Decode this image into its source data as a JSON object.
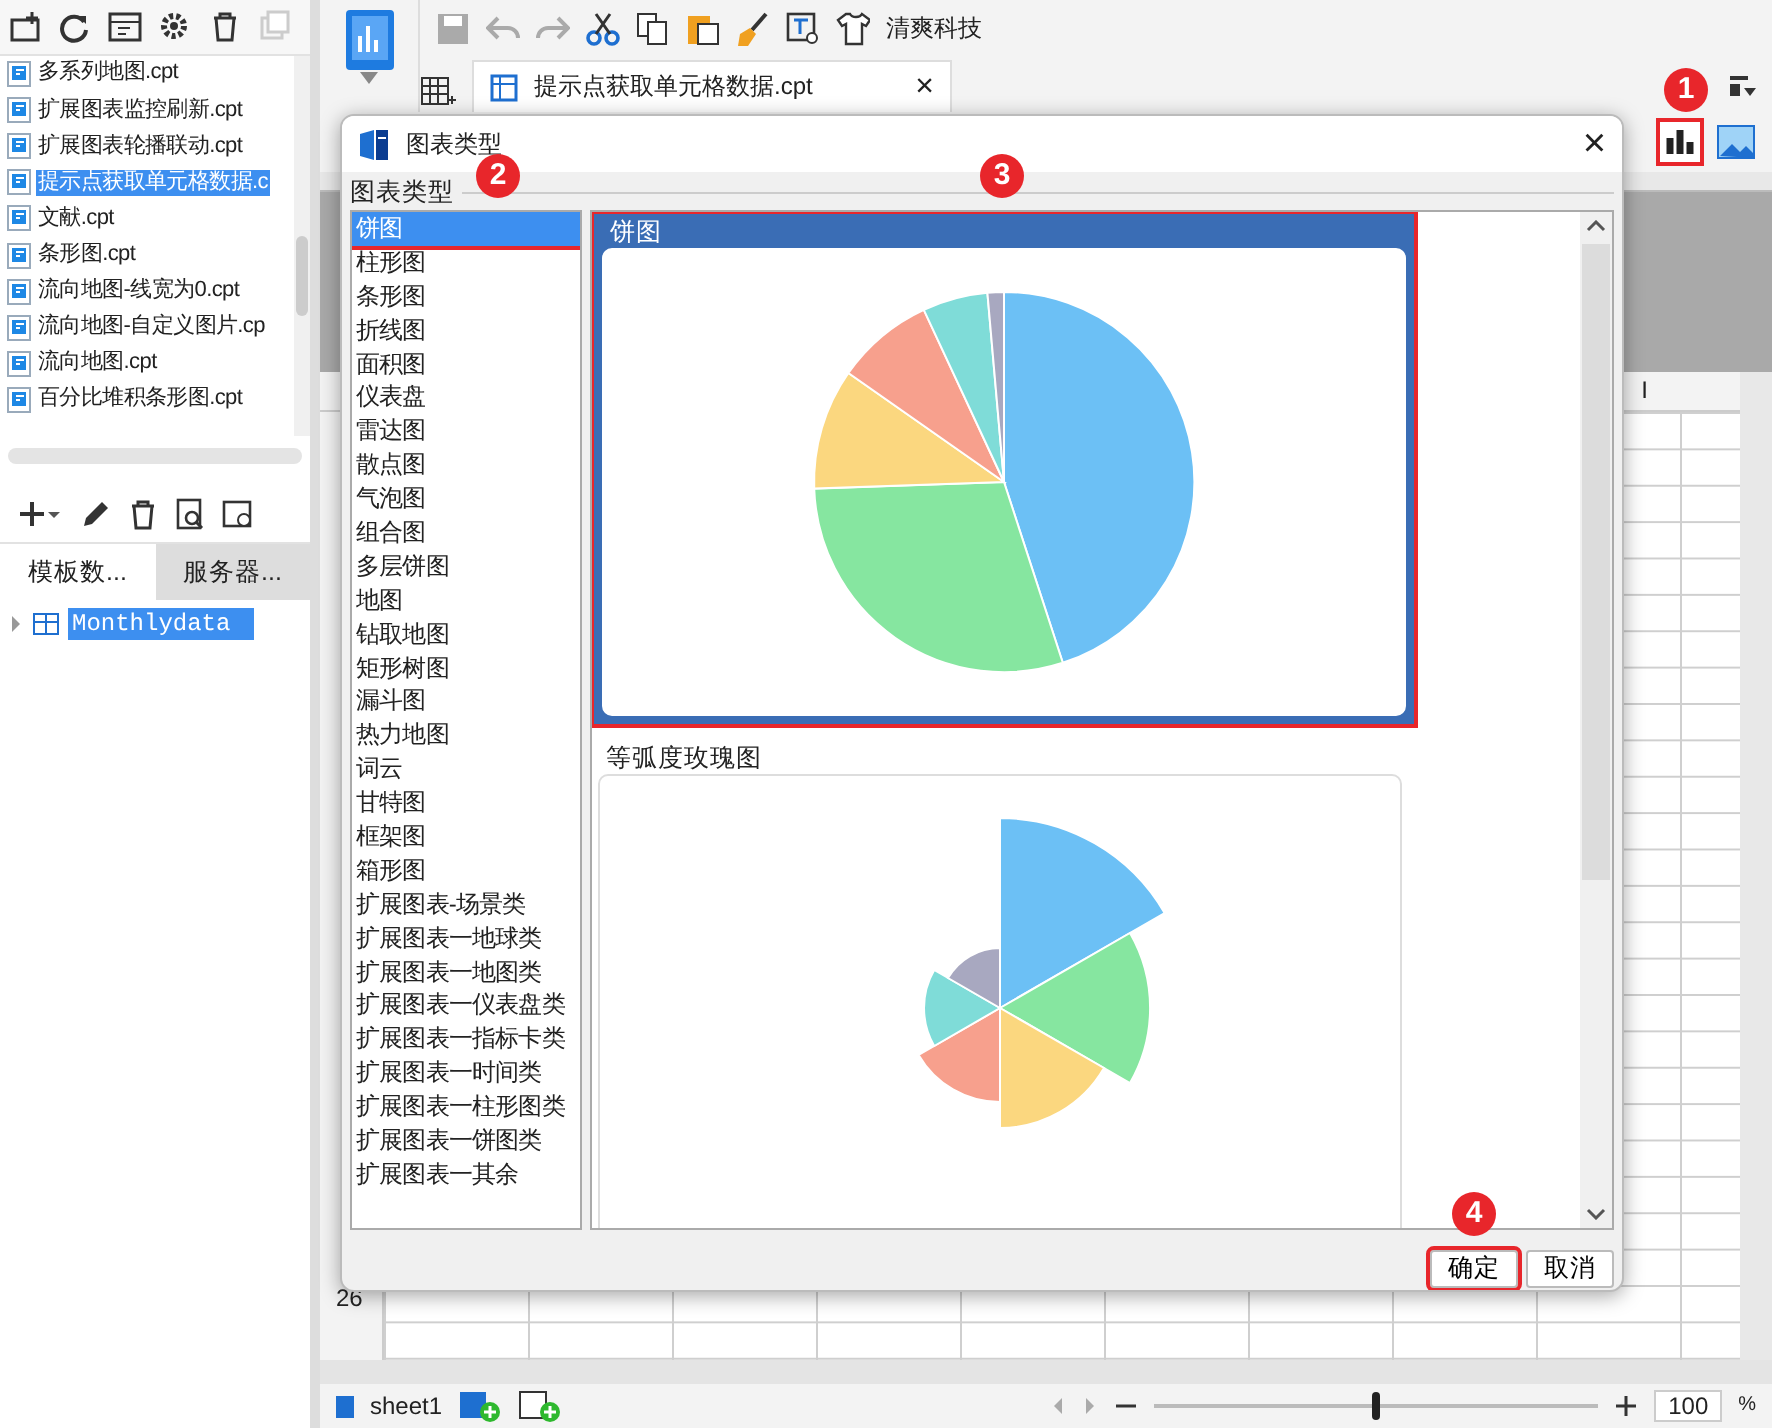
{
  "left_panel": {
    "files": [
      {
        "name": "多系列地图.cpt",
        "selected": false
      },
      {
        "name": "扩展图表监控刷新.cpt",
        "selected": false
      },
      {
        "name": "扩展图表轮播联动.cpt",
        "selected": false
      },
      {
        "name": "提示点获取单元格数据.c",
        "selected": true
      },
      {
        "name": "文献.cpt",
        "selected": false
      },
      {
        "name": "条形图.cpt",
        "selected": false
      },
      {
        "name": "流向地图-线宽为0.cpt",
        "selected": false
      },
      {
        "name": "流向地图-自定义图片.cp",
        "selected": false
      },
      {
        "name": "流向地图.cpt",
        "selected": false
      },
      {
        "name": "百分比堆积条形图.cpt",
        "selected": false
      }
    ],
    "tabs": [
      {
        "label": "模板数...",
        "selected": true
      },
      {
        "label": "服务器...",
        "selected": false
      }
    ],
    "tree": [
      {
        "label": "Monthlydata",
        "selected": true
      }
    ]
  },
  "toolbar": {
    "brand": "清爽科技"
  },
  "doc_tab": {
    "title": "提示点获取单元格数据.cpt",
    "close": "×"
  },
  "sheet": {
    "column_header": "I",
    "row_numbers": [
      "26"
    ]
  },
  "bottom_bar": {
    "sheet_tab": "sheet1",
    "zoom": "100",
    "zoom_unit": "%",
    "level": 0.5
  },
  "dialog": {
    "title": "图表类型",
    "close": "×",
    "group_label": "图表类型",
    "types": [
      {
        "label": "饼图",
        "selected": true
      },
      {
        "label": "柱形图",
        "selected": false
      },
      {
        "label": "条形图",
        "selected": false
      },
      {
        "label": "折线图",
        "selected": false
      },
      {
        "label": "面积图",
        "selected": false
      },
      {
        "label": "仪表盘",
        "selected": false
      },
      {
        "label": "雷达图",
        "selected": false
      },
      {
        "label": "散点图",
        "selected": false
      },
      {
        "label": "气泡图",
        "selected": false
      },
      {
        "label": "组合图",
        "selected": false
      },
      {
        "label": "多层饼图",
        "selected": false
      },
      {
        "label": "地图",
        "selected": false
      },
      {
        "label": "钻取地图",
        "selected": false
      },
      {
        "label": "矩形树图",
        "selected": false
      },
      {
        "label": "漏斗图",
        "selected": false
      },
      {
        "label": "热力地图",
        "selected": false
      },
      {
        "label": "词云",
        "selected": false
      },
      {
        "label": "甘特图",
        "selected": false
      },
      {
        "label": "框架图",
        "selected": false
      },
      {
        "label": "箱形图",
        "selected": false
      },
      {
        "label": "扩展图表-场景类",
        "selected": false
      },
      {
        "label": "扩展图表一地球类",
        "selected": false
      },
      {
        "label": "扩展图表一地图类",
        "selected": false
      },
      {
        "label": "扩展图表一仪表盘类",
        "selected": false
      },
      {
        "label": "扩展图表一指标卡类",
        "selected": false
      },
      {
        "label": "扩展图表一时间类",
        "selected": false
      },
      {
        "label": "扩展图表一柱形图类",
        "selected": false
      },
      {
        "label": "扩展图表一饼图类",
        "selected": false
      },
      {
        "label": "扩展图表一其余",
        "selected": false
      }
    ],
    "previews": [
      {
        "title": "饼图",
        "kind": "pie",
        "selected": true
      },
      {
        "title": "等弧度玫瑰图",
        "kind": "rose",
        "selected": false
      }
    ],
    "buttons": [
      {
        "label": "确定",
        "kind": "ok"
      },
      {
        "label": "取消",
        "kind": "cancel"
      }
    ]
  },
  "annotations": [
    {
      "number": "1"
    },
    {
      "number": "2"
    },
    {
      "number": "3"
    },
    {
      "number": "4"
    }
  ]
}
